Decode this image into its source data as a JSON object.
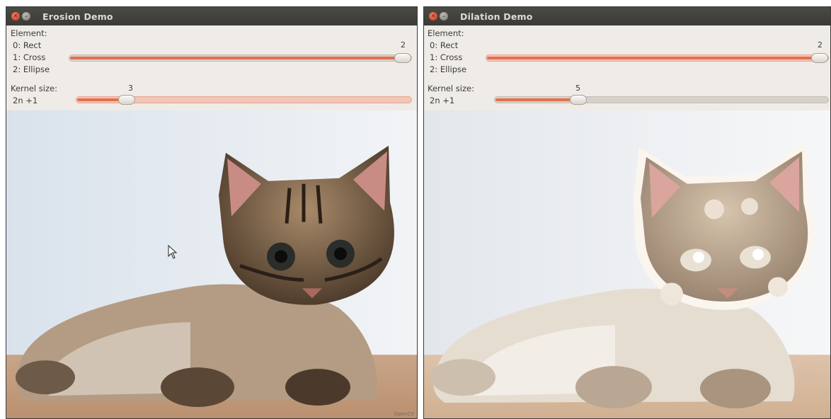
{
  "erosion_window": {
    "title": "Erosion Demo",
    "element_label": "Element:",
    "element_options": [
      "0: Rect",
      "1: Cross",
      "2: Ellipse"
    ],
    "element_value": "2",
    "element_fraction": 1.0,
    "kernel_label": "Kernel size:",
    "kernel_formula": "2n +1",
    "kernel_value": "3",
    "kernel_fraction": 0.15,
    "watermark": "OpenCV",
    "icons": [
      "close-icon",
      "minimize-icon",
      "mouse-cursor-icon"
    ]
  },
  "dilation_window": {
    "title": "Dilation Demo",
    "element_label": "Element:",
    "element_options": [
      "0: Rect",
      "1: Cross",
      "2: Ellipse"
    ],
    "element_value": "2",
    "element_fraction": 1.0,
    "kernel_label": "Kernel size:",
    "kernel_formula": "2n +1",
    "kernel_value": "5",
    "kernel_fraction": 0.25,
    "icons": [
      "close-icon",
      "minimize-icon"
    ]
  },
  "colors": {
    "titlebar": "#3f3e3a",
    "panel": "#efebe6",
    "slider_fill": "#e36f52",
    "close_button": "#e0603c"
  }
}
